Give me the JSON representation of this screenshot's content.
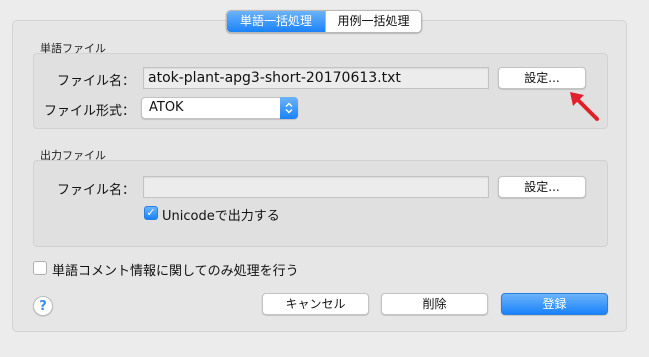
{
  "tabs": [
    {
      "label": "単語一括処理",
      "active": true
    },
    {
      "label": "用例一括処理",
      "active": false
    }
  ],
  "word_file": {
    "section_label": "単語ファイル",
    "filename_label": "ファイル名：",
    "filename_value": "atok-plant-apg3-short-20170613.txt",
    "settings_button": "設定...",
    "format_label": "ファイル形式：",
    "format_value": "ATOK"
  },
  "output_file": {
    "section_label": "出力ファイル",
    "filename_label": "ファイル名：",
    "filename_value": "",
    "settings_button": "設定...",
    "unicode_label": "Unicodeで出力する",
    "unicode_checked": true
  },
  "options": {
    "comment_only_label": "単語コメント情報に関してのみ処理を行う",
    "comment_only_checked": false
  },
  "footer": {
    "help_label": "?",
    "cancel_button": "キャンセル",
    "delete_button": "削除",
    "register_button": "登録"
  },
  "colors": {
    "accent": "#1a82fb",
    "annotation_arrow": "#e0202a"
  }
}
